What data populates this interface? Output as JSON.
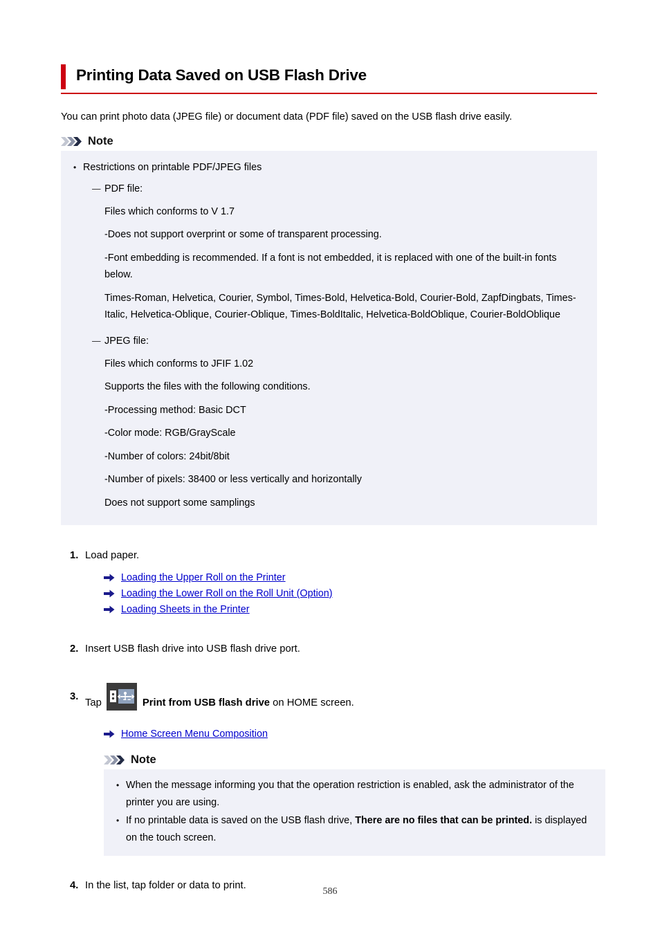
{
  "document": {
    "title": "Printing Data Saved on USB Flash Drive",
    "intro": "You can print photo data (JPEG file) or document data (PDF file) saved on the USB flash drive easily.",
    "page_number": "586",
    "accent_color": "#cc0011",
    "note_bg_color": "#f0f1f8",
    "link_color": "#0000cc"
  },
  "note_top": {
    "label": "Note",
    "icon": "triple-chevron-icon",
    "bullet": "Restrictions on printable PDF/JPEG files",
    "pdf": {
      "heading": "PDF file:",
      "lines": [
        "Files which conforms to V 1.7",
        "-Does not support overprint or some of transparent processing.",
        "-Font embedding is recommended. If a font is not embedded, it is replaced with one of the built-in fonts below.",
        "Times-Roman, Helvetica, Courier, Symbol, Times-Bold, Helvetica-Bold, Courier-Bold, ZapfDingbats, Times-Italic, Helvetica-Oblique, Courier-Oblique, Times-BoldItalic, Helvetica-BoldOblique, Courier-BoldOblique"
      ]
    },
    "jpeg": {
      "heading": "JPEG file:",
      "lines": [
        "Files which conforms to JFIF 1.02",
        "Supports the files with the following conditions.",
        "-Processing method: Basic DCT",
        "-Color mode: RGB/GrayScale",
        "-Number of colors: 24bit/8bit",
        "-Number of pixels: 38400 or less vertically and horizontally",
        "Does not support some samplings"
      ]
    }
  },
  "steps": {
    "step1": {
      "number": "1.",
      "text": "Load paper.",
      "links": [
        "Loading the Upper Roll on the Printer",
        "Loading the Lower Roll on the Roll Unit (Option)",
        "Loading Sheets in the Printer"
      ]
    },
    "step2": {
      "number": "2.",
      "text": "Insert USB flash drive into USB flash drive port."
    },
    "step3": {
      "number": "3.",
      "prefix": "Tap",
      "icon": "usb-flash-drive-icon",
      "bold_text": "Print from USB flash drive",
      "suffix": "on HOME screen.",
      "link": "Home Screen Menu Composition",
      "note": {
        "label": "Note",
        "icon": "triple-chevron-icon",
        "bullets": [
          {
            "lead": "When the message informing you that the operation restriction is enabled, ask the administrator of the printer you are using.",
            "bold": "",
            "tail": ""
          },
          {
            "lead": "If no printable data is saved on the USB flash drive, ",
            "bold": "There are no files that can be printed.",
            "tail": " is displayed on the touch screen."
          }
        ]
      }
    },
    "step4": {
      "number": "4.",
      "text": "In the list, tap folder or data to print."
    }
  }
}
